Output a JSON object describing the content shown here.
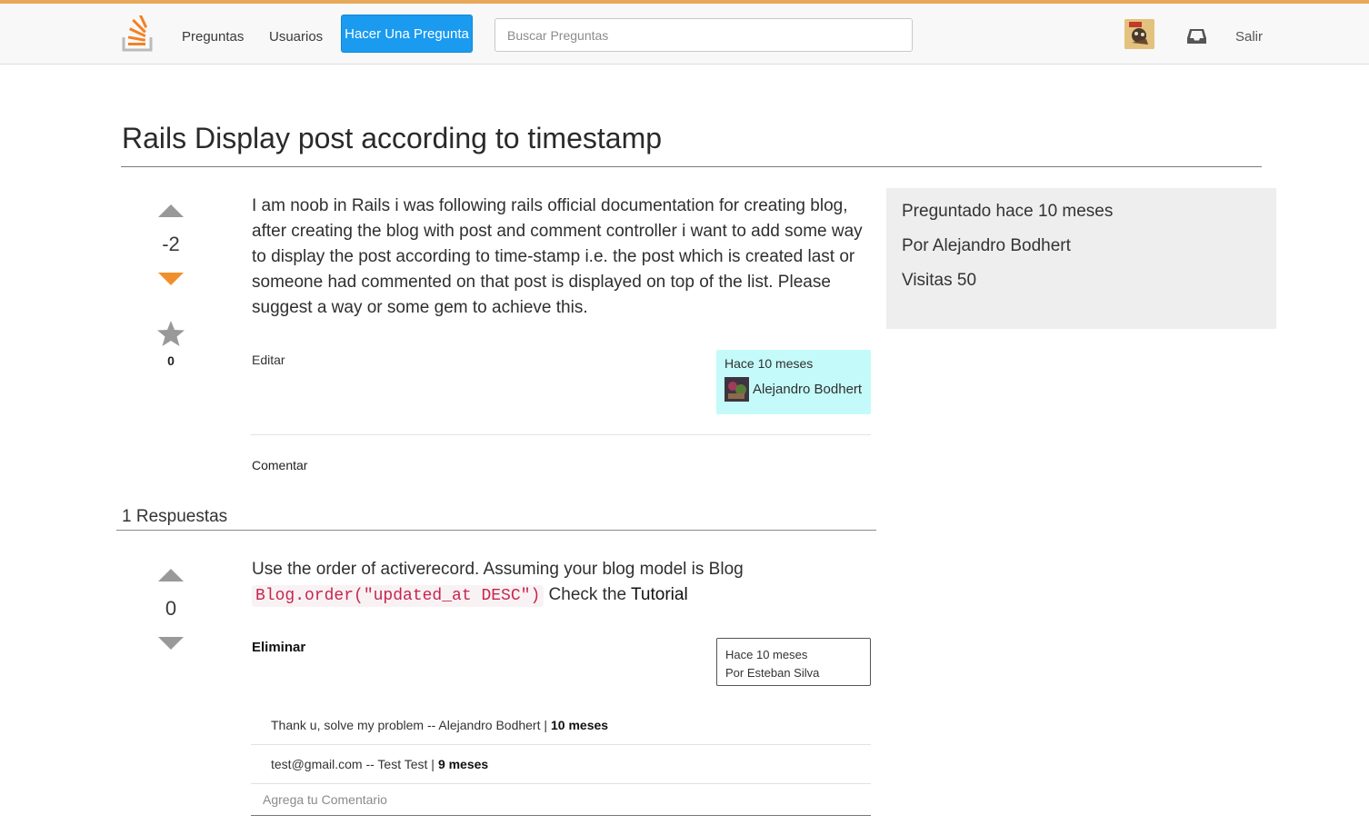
{
  "nav": {
    "logo_icon": "stackoverflow-logo-icon",
    "preguntas": "Preguntas",
    "usuarios": "Usuarios",
    "ask_button": "Hacer Una Pregunta",
    "search_placeholder": "Buscar Preguntas",
    "inbox_icon": "inbox-icon",
    "logout": "Salir"
  },
  "question": {
    "title": "Rails Display post according to timestamp",
    "votes": "-2",
    "favorites": "0",
    "body": "I am noob in Rails i was following rails official documentation for creating blog, after creating the blog with post and comment controller i want to add some way to display the post according to time-stamp i.e. the post which is created last or someone had commented on that post is displayed on top of the list. Please suggest a way or some gem to achieve this.",
    "edit_label": "Editar",
    "author_time": "Hace 10 meses",
    "author_name": "Alejandro Bodhert",
    "comment_label": "Comentar"
  },
  "sidebar": {
    "asked": "Preguntado hace 10 meses",
    "by": "Por Alejandro Bodhert",
    "views": "Visitas 50"
  },
  "answers": {
    "heading": "1 Respuestas",
    "items": [
      {
        "votes": "0",
        "body_text": "Use the order of activerecord. Assuming your blog model is Blog",
        "code": "Blog.order(\"updated_at DESC\")",
        "check_text": "Check the",
        "link_text": "Tutorial",
        "delete_label": "Eliminar",
        "author_time": "Hace 10 meses",
        "author_by": "Por Esteban Silva",
        "comments": [
          {
            "text": "Thank u, solve my problem -- Alejandro Bodhert |",
            "age": "10 meses"
          },
          {
            "text": "test@gmail.com -- Test Test |",
            "age": "9 meses"
          }
        ],
        "comment_placeholder": "Agrega tu Comentario"
      }
    ]
  },
  "colors": {
    "accent_top_border": "#e8a85a",
    "ask_button": "#1a9bef",
    "downvote_active": "#f0902c",
    "vote_inactive": "#999999",
    "author_card_bg": "#c4fbfa",
    "sidebar_bg": "#eeeeee",
    "code_text": "#c7254e"
  }
}
